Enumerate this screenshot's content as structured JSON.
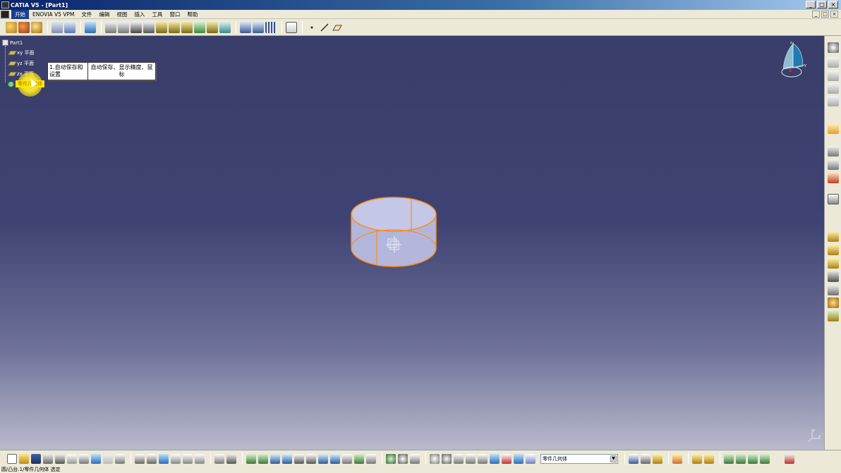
{
  "window": {
    "title": "CATIA V5 - [Part1]",
    "controls": [
      "_",
      "□",
      "×"
    ],
    "mdi_controls": [
      "_",
      "□",
      "×"
    ]
  },
  "menubar": {
    "items": [
      "开始",
      "ENOVIA V5 VPM",
      "文件",
      "编辑",
      "视图",
      "插入",
      "工具",
      "窗口",
      "帮助"
    ],
    "active_index": 0
  },
  "tree": {
    "root": "Part1",
    "nodes": [
      "xy 平面",
      "yz 平面",
      "zx 平面",
      "零件几何体"
    ]
  },
  "tooltip": {
    "left": "1.自动保存和设置",
    "right": "自动保存、显示精度、鼠标"
  },
  "bottom_toolbar": {
    "combo_value": "零件几何体",
    "combo_arrow": "▼"
  },
  "statusbar": {
    "text": "圆/凸台.1/零件几何体 选定"
  },
  "colors": {
    "viewport_top": "#393d69",
    "viewport_bottom": "#b9bacd",
    "highlight_edge": "#ff8c1a",
    "cylinder_fill": "#b9bde0",
    "tree_selected": "#ffe600"
  },
  "icons": {
    "top_toolbar": [
      "sketcher-icon",
      "workbench-icon",
      "part-design-icon",
      "view-icon",
      "layer-icon",
      "pad-icon",
      "pocket-icon",
      "shaft-icon",
      "hole-icon",
      "rib-icon",
      "fillet-icon",
      "chamfer-icon",
      "draft-icon",
      "shell-icon",
      "boolean-icon",
      "pattern-icon",
      "grid-icon",
      "point-icon",
      "line-icon",
      "plane-icon"
    ],
    "right_toolbar": [
      "compass-settings-icon",
      "material-icon",
      "apply-material-icon",
      "render-icon",
      "select-icon",
      "measure-icon",
      "analysis-icon",
      "constraint-icon",
      "sketch-icon",
      "solid-icon",
      "surface-icon",
      "thick-icon",
      "mirror-icon",
      "axis-icon",
      "body-icon"
    ]
  }
}
